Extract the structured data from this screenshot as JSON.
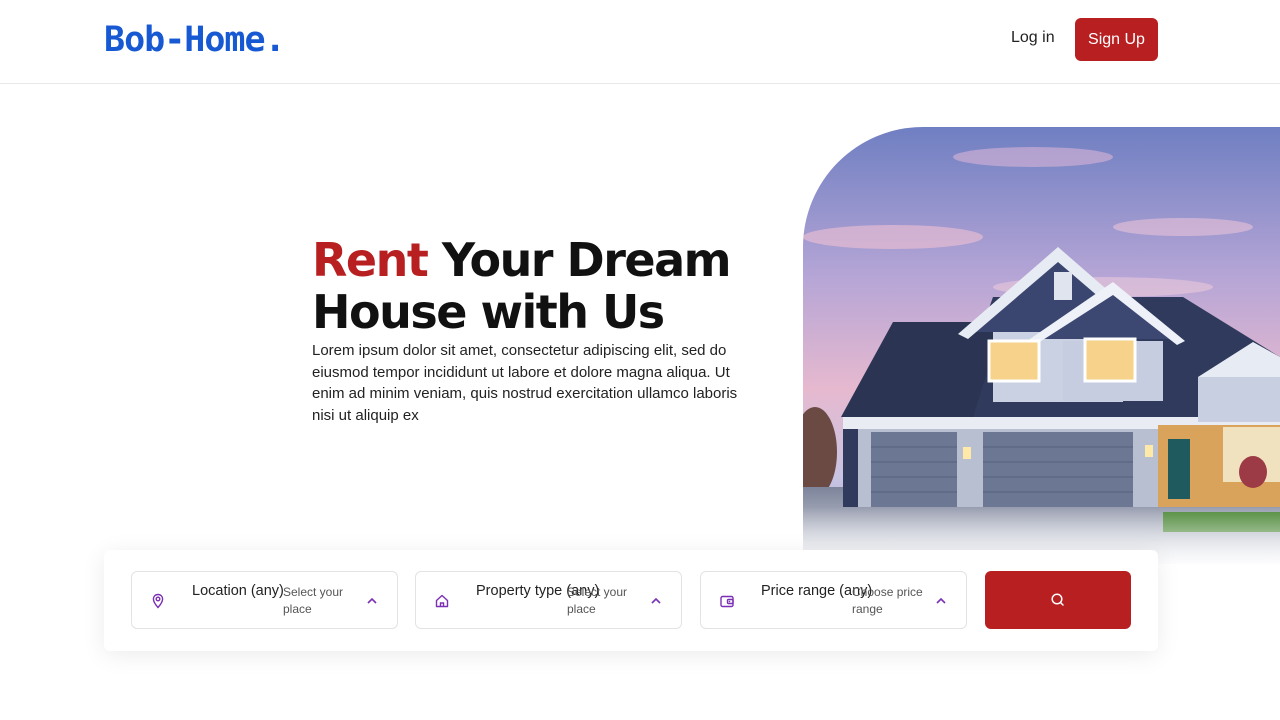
{
  "brand": {
    "logo": "Bob-Home.",
    "logo_color": "#1758d3"
  },
  "nav": {
    "login_label": "Log in",
    "signup_label": "Sign Up"
  },
  "hero": {
    "title_accent": "Rent",
    "title_rest_line1": " Your Dream",
    "title_line2": "House with Us",
    "description": "Lorem ipsum dolor sit amet, consectetur adipiscing elit, sed do eiusmod tempor incididunt ut labore et dolore magna aliqua. Ut enim ad minim veniam, quis nostrud exercitation ullamco laboris nisi ut aliquip ex",
    "accent_color": "#b81f21"
  },
  "search": {
    "filters": [
      {
        "label": "Location (any)",
        "hint": "Select your place",
        "icon": "map-pin-icon"
      },
      {
        "label": "Property type (any)",
        "hint": "Select your place",
        "icon": "home-icon"
      },
      {
        "label": "Price range (any)",
        "hint": "Choose price range",
        "icon": "wallet-icon"
      }
    ],
    "button_icon": "search-icon",
    "icon_color": "#7b2fb5"
  }
}
